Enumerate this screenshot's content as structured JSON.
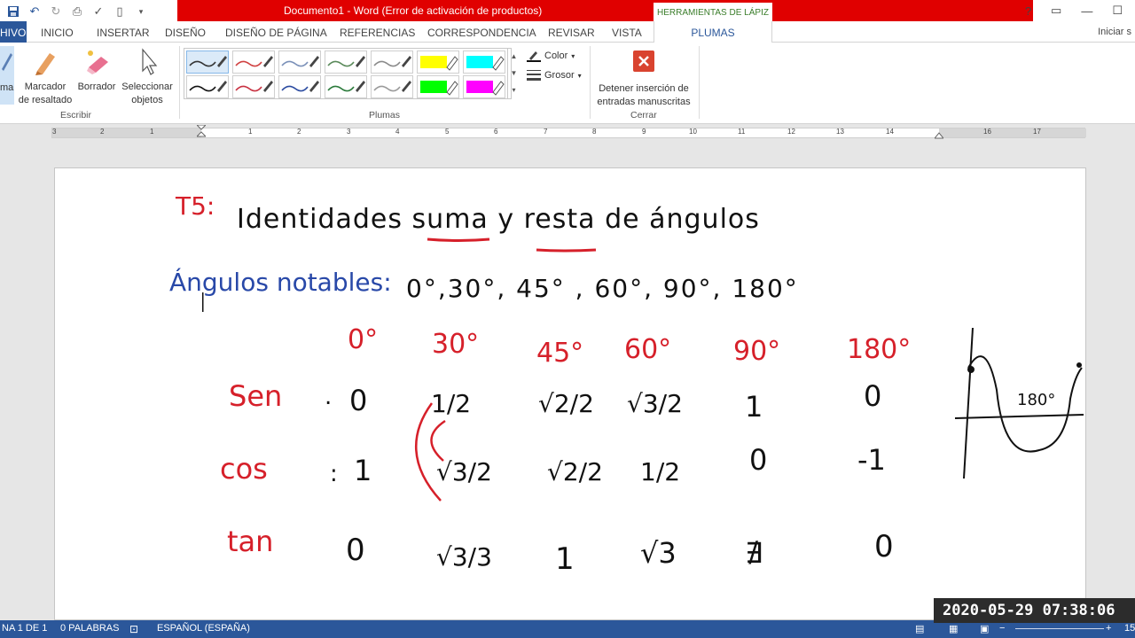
{
  "window": {
    "title": "Documento1 - Word (Error de activación de productos)",
    "context_tab_group": "HERRAMIENTAS DE LÁPIZ",
    "controls": [
      "?",
      "▭",
      "—",
      "☐"
    ]
  },
  "ribbon_tabs": {
    "file": "HIVO",
    "items": [
      "INICIO",
      "INSERTAR",
      "DISEÑO",
      "DISEÑO DE PÁGINA",
      "REFERENCIAS",
      "CORRESPONDENCIA",
      "REVISAR",
      "VISTA"
    ],
    "active": "PLUMAS",
    "signin": "Iniciar s"
  },
  "ribbon": {
    "escribir": {
      "pen_partial": "ma",
      "marcador": "Marcador de resaltado",
      "marcador_l1": "Marcador",
      "marcador_l2": "de resaltado",
      "borrador": "Borrador",
      "seleccionar_l1": "Seleccionar",
      "seleccionar_l2": "objetos",
      "group": "Escribir"
    },
    "plumas": {
      "group": "Plumas",
      "color_label": "Color",
      "grosor_label": "Grosor",
      "pens_row1": [
        {
          "color": "#333333",
          "kind": "pen"
        },
        {
          "color": "#d04040",
          "kind": "pen"
        },
        {
          "color": "#7a90b8",
          "kind": "pen"
        },
        {
          "color": "#5a8a5a",
          "kind": "pen"
        },
        {
          "color": "#8a8a8a",
          "kind": "pen"
        },
        {
          "color": "#ffff00",
          "kind": "highlighter"
        },
        {
          "color": "#00ffff",
          "kind": "highlighter"
        }
      ],
      "pens_row2": [
        {
          "color": "#111111",
          "kind": "pen"
        },
        {
          "color": "#c83040",
          "kind": "pen"
        },
        {
          "color": "#2a4aa0",
          "kind": "pen"
        },
        {
          "color": "#2a7a3a",
          "kind": "pen"
        },
        {
          "color": "#9a9a9a",
          "kind": "pen"
        },
        {
          "color": "#00ff00",
          "kind": "highlighter"
        },
        {
          "color": "#ff00ff",
          "kind": "highlighter"
        }
      ]
    },
    "cerrar": {
      "detener_l1": "Detener inserción de",
      "detener_l2": "entradas manuscritas",
      "group": "Cerrar"
    }
  },
  "ruler": {
    "numbers": [
      "3",
      "2",
      "1",
      "1",
      "2",
      "3",
      "4",
      "5",
      "6",
      "7",
      "8",
      "9",
      "10",
      "11",
      "12",
      "13",
      "14",
      "16",
      "17"
    ]
  },
  "document": {
    "title_prefix": "T5:",
    "title_text": "Identidades suma y resta de ángulos",
    "notables_label": "Ángulos notables:",
    "notables_values": "0°,30°, 45° , 60°, 90°, 180°",
    "angles": [
      "0°",
      "30°",
      "45°",
      "60°",
      "90°",
      "180°"
    ],
    "rows": [
      {
        "fn": "Sen",
        "values": [
          "0",
          "1/2",
          "√2/2",
          "√3/2",
          "1",
          "0"
        ]
      },
      {
        "fn": "cos",
        "values": [
          "1",
          "√3/2",
          "√2/2",
          "1/2",
          "0",
          "-1"
        ]
      },
      {
        "fn": "tan",
        "values": [
          "0",
          "√3/3",
          "1",
          "√3",
          "∄",
          "0"
        ]
      }
    ],
    "graph_label": "180°"
  },
  "status_bar": {
    "page": "NA 1 DE 1",
    "words": "0 PALABRAS",
    "language": "ESPAÑOL (ESPAÑA)",
    "zoom": "15"
  },
  "overlay": {
    "timestamp": "2020-05-29 07:38:06"
  },
  "colors": {
    "word_blue": "#2b579a",
    "title_red": "#e00000",
    "ink_red": "#d6202a",
    "ink_blue": "#2848a8",
    "ink_black": "#111111"
  }
}
